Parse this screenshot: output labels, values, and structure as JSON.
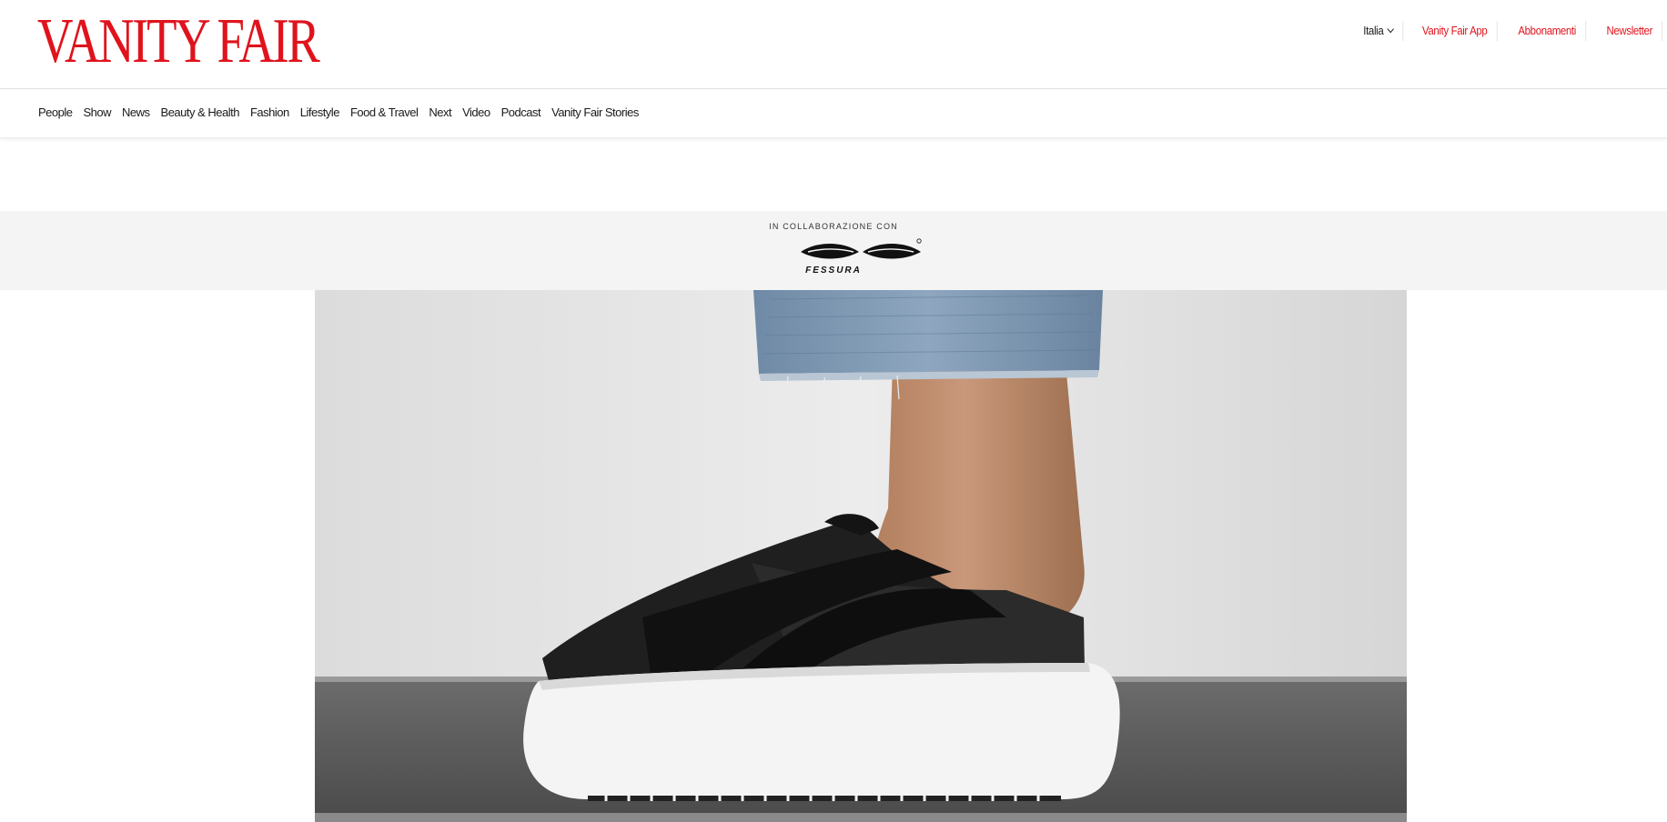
{
  "brand": {
    "logo_text": "VANITY FAIR",
    "accent_color": "#e0131c"
  },
  "utility": {
    "language": "Italia",
    "language_icon": "chevron-down-icon",
    "links": [
      "Vanity Fair App",
      "Abbonamenti",
      "Newsletter"
    ]
  },
  "nav": {
    "items": [
      "People",
      "Show",
      "News",
      "Beauty & Health",
      "Fashion",
      "Lifestyle",
      "Food & Travel",
      "Next",
      "Video",
      "Podcast",
      "Vanity Fair Stories"
    ]
  },
  "sponsor": {
    "label": "IN COLLABORAZIONE CON",
    "name": "FESSURA"
  },
  "hero": {
    "image_icon": "sneaker-photo"
  }
}
